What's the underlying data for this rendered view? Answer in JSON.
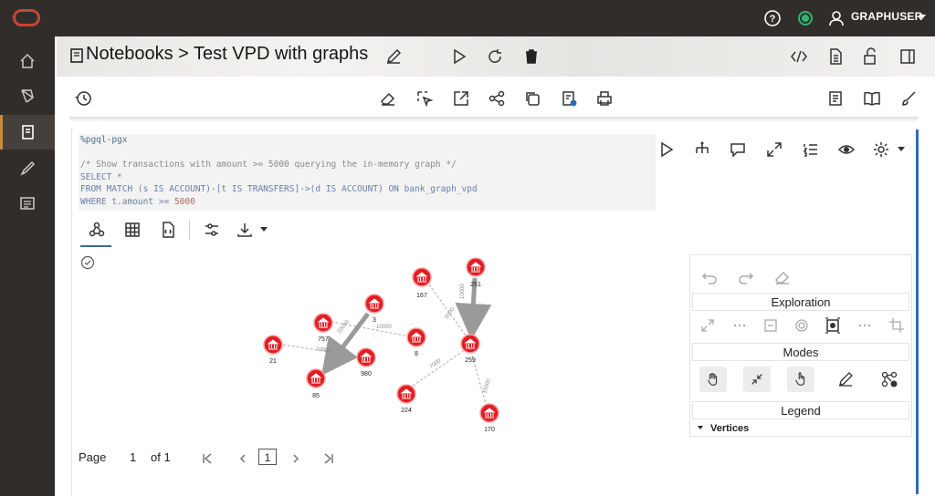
{
  "top_bar": {
    "user_name": "GRAPHUSER",
    "icons": [
      "oracle-logo-icon",
      "help-icon",
      "status-icon",
      "user-icon",
      "chevron-down-icon"
    ],
    "status_color": "#2bb673",
    "brand_color": "#c74634"
  },
  "sidebar": {
    "items": [
      {
        "name": "home-icon"
      },
      {
        "name": "models-icon"
      },
      {
        "name": "notebooks-icon",
        "active": true
      },
      {
        "name": "editor-icon"
      },
      {
        "name": "jobs-icon"
      }
    ]
  },
  "header": {
    "breadcrumb": "Notebooks > Test VPD with graphs",
    "actions": [
      "edit-icon",
      "run-icon",
      "refresh-icon",
      "delete-icon",
      "code-icon",
      "document-icon",
      "unlock-icon",
      "panel-icon"
    ]
  },
  "toolbar": {
    "actions": [
      "history-icon",
      "eraser-icon",
      "select-icon",
      "export-icon",
      "share-icon",
      "copy-icon",
      "settings-icon",
      "print-icon",
      "format-icon",
      "book-icon",
      "brush-icon"
    ]
  },
  "paragraph": {
    "code_lines": [
      {
        "text": "%pgql-pgx",
        "kind": "dir"
      },
      {
        "text": "",
        "kind": "blank"
      },
      {
        "text": "/* Show transactions with amount >= 5000 querying the in-memory graph */",
        "kind": "comment"
      },
      {
        "text": "SELECT *",
        "kind": "kw"
      },
      {
        "text": "FROM MATCH (s IS ACCOUNT)-[t IS TRANSFERS]->(d IS ACCOUNT) ON bank_graph_vpd",
        "kind": "kw"
      },
      {
        "text": "WHERE t.amount >= 5000",
        "kind": "kw"
      }
    ],
    "line1": "%pgql-pgx",
    "line3": "/* Show transactions with amount >= 5000 querying the in-memory graph */",
    "line4": "SELECT *",
    "line5": "FROM MATCH (s IS ACCOUNT)-[t IS TRANSFERS]->(d IS ACCOUNT) ON bank_graph_vpd",
    "line6_kw": "WHERE t.amount >= ",
    "line6_num": "5000"
  },
  "graph": {
    "nodes": [
      {
        "id": "167",
        "label": "167"
      },
      {
        "id": "251",
        "label": "251"
      },
      {
        "id": "3",
        "label": "3"
      },
      {
        "id": "757",
        "label": "757"
      },
      {
        "id": "8",
        "label": "8"
      },
      {
        "id": "21",
        "label": "21"
      },
      {
        "id": "980",
        "label": "980"
      },
      {
        "id": "85",
        "label": "85"
      },
      {
        "id": "259",
        "label": "259"
      },
      {
        "id": "224",
        "label": "224"
      },
      {
        "id": "170",
        "label": "170"
      }
    ],
    "node_color": "#e21d23",
    "edge_color": "#9a9a9a"
  },
  "pagination": {
    "page_label": "Page",
    "current": "1",
    "of_label": "of 1",
    "page_input": "1"
  },
  "panel": {
    "exploration_label": "Exploration",
    "modes_label": "Modes",
    "legend_label": "Legend",
    "vertices_label": "Vertices"
  }
}
